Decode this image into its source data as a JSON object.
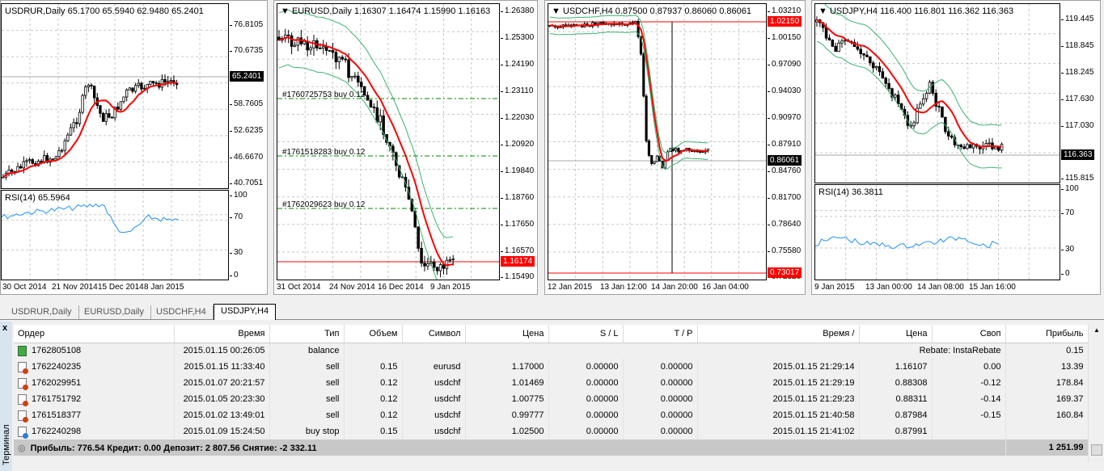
{
  "charts": [
    {
      "title": "USDRUR,Daily  65.1700 65.5940 62.9480 65.2401",
      "prices": [
        "76.8105",
        "70.6735",
        "58.7605",
        "52.6235",
        "46.6670",
        "40.7051"
      ],
      "current": "65.2401",
      "rsi_title": "RSI(14) 65.5964",
      "rsi_levels": [
        "100",
        "70",
        "30",
        "0"
      ],
      "times": [
        "30 Oct 2014",
        "21 Nov 2014",
        "15 Dec 2014",
        "8 Jan 2015"
      ]
    },
    {
      "title": "EURUSD,Daily  1.16307 1.16474 1.15990 1.16163",
      "prices": [
        "1.26380",
        "1.25300",
        "1.24190",
        "1.23110",
        "1.22030",
        "1.20920",
        "1.19840",
        "1.18760",
        "1.17650",
        "1.16570",
        "1.15490"
      ],
      "current": "1.16174",
      "orders": [
        "#1760725753 buy 0.12",
        "#1761518283 buy 0.12",
        "#1762029623 buy 0.12"
      ],
      "times": [
        "31 Oct 2014",
        "24 Nov 2014",
        "16 Dec 2014",
        "9 Jan 2015"
      ]
    },
    {
      "title": "USDCHF,H4  0.87500 0.87937 0.86060 0.86061",
      "prices": [
        "1.03210",
        "1.00150",
        "0.97090",
        "0.94030",
        "0.90970",
        "0.87910",
        "0.84760",
        "0.81700",
        "0.78640",
        "0.75580",
        "0.72520"
      ],
      "current": "0.86061",
      "level_high": "1.02150",
      "level_low": "0.73017",
      "times": [
        "12 Jan 2015",
        "13 Jan 12:00",
        "14 Jan 20:00",
        "16 Jan 04:00"
      ]
    },
    {
      "title": "USDJPY,H4  116.400 116.801 116.362 116.363",
      "prices": [
        "119.445",
        "118.845",
        "118.245",
        "117.630",
        "117.030",
        "115.815"
      ],
      "current": "116.363",
      "rsi_title": "RSI(14) 36.3811",
      "rsi_levels": [
        "100",
        "70",
        "30",
        "0"
      ],
      "times": [
        "9 Jan 2015",
        "13 Jan 00:00",
        "14 Jan 08:00",
        "15 Jan 16:00"
      ]
    }
  ],
  "tabs": [
    "USDRUR,Daily",
    "EURUSD,Daily",
    "USDCHF,H4",
    "USDJPY,H4"
  ],
  "active_tab": "USDJPY,H4",
  "terminal": {
    "close": "x",
    "label": "Терминал",
    "columns": [
      "Ордер",
      "Время",
      "Тип",
      "Объем",
      "Символ",
      "Цена",
      "S / L",
      "T / P",
      "Время  /",
      "Цена",
      "Своп",
      "Прибыль"
    ],
    "balance_row": {
      "order": "1762805108",
      "time": "2015.01.15 00:26:05",
      "type": "balance",
      "comment": "Rebate: InstaRebate",
      "profit": "0.15"
    },
    "rows": [
      [
        "1762240235",
        "2015.01.15 11:33:40",
        "sell",
        "0.15",
        "eurusd",
        "1.17000",
        "0.00000",
        "0.00000",
        "2015.01.15 21:29:14",
        "1.16107",
        "0.00",
        "13.39"
      ],
      [
        "1762029951",
        "2015.01.07 20:21:57",
        "sell",
        "0.12",
        "usdchf",
        "1.01469",
        "0.00000",
        "0.00000",
        "2015.01.15 21:29:19",
        "0.88308",
        "-0.12",
        "178.84"
      ],
      [
        "1761751792",
        "2015.01.05 20:23:30",
        "sell",
        "0.12",
        "usdchf",
        "1.00775",
        "0.00000",
        "0.00000",
        "2015.01.15 21:29:23",
        "0.88311",
        "-0.14",
        "169.37"
      ],
      [
        "1761518377",
        "2015.01.02 13:49:01",
        "sell",
        "0.12",
        "usdchf",
        "0.99777",
        "0.00000",
        "0.00000",
        "2015.01.15 21:40:58",
        "0.87984",
        "-0.15",
        "160.84"
      ],
      [
        "1762240298",
        "2015.01.09 15:24:50",
        "buy stop",
        "0.15",
        "usdchf",
        "1.02500",
        "0.00000",
        "0.00000",
        "2015.01.15 21:41:02",
        "0.87991",
        "",
        ""
      ]
    ],
    "summary": "Прибыль: 776.54  Кредит: 0.00  Депозит: 2 807.56  Снятие: -2 332.11",
    "total": "1 251.99"
  }
}
